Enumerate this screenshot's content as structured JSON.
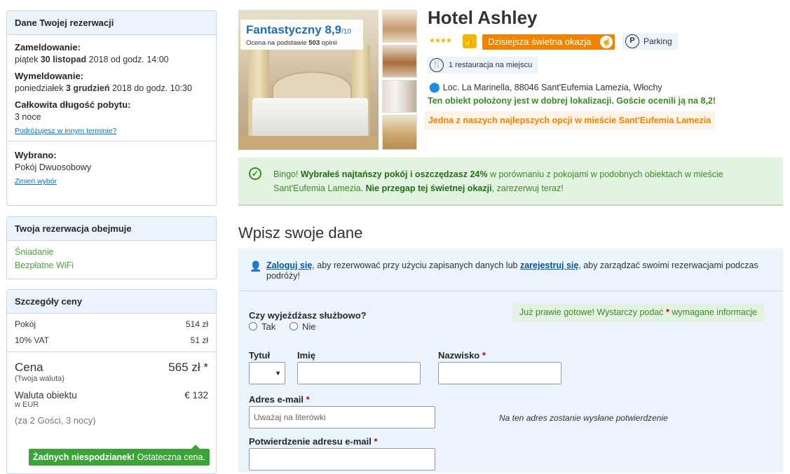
{
  "sidebar": {
    "booking": {
      "title": "Dane Twojej rezerwacji",
      "checkin_label": "Zameldowanie:",
      "checkin_prefix": "piątek",
      "checkin_date": "30 listopad",
      "checkin_suffix": "2018 od godz. 14:00",
      "checkout_label": "Wymeldowanie:",
      "checkout_prefix": "poniedziałek",
      "checkout_date": "3 grudzień",
      "checkout_suffix": "2018 do godz. 10:30",
      "length_label": "Całkowita długość pobytu:",
      "length_value": "3 noce",
      "other_dates_link": "Podróżujesz w innym terminie?",
      "selected_label": "Wybrano:",
      "selected_value": "Pokój Dwuosobowy",
      "change_link": "Zmień wybór"
    },
    "includes": {
      "title": "Twoja rezerwacja obejmuje",
      "items": [
        "Śniadanie",
        "Bezpłatne WiFi"
      ]
    },
    "price": {
      "title": "Szczegóły ceny",
      "rows": [
        {
          "label": "Pokój",
          "value": "514 zł"
        },
        {
          "label": "10% VAT",
          "value": "51 zł"
        }
      ],
      "total_label": "Cena",
      "total_value": "565 zł *",
      "total_note": "(Twoja waluta)",
      "property_currency_label": "Waluta obiektu",
      "property_currency_value": "€ 132",
      "property_currency_note": "w EUR",
      "guests_note": "(za 2 Gości, 3 nocy)",
      "no_surprise_bold": "Żadnych niespodzianek!",
      "no_surprise_rest": " Ostateczna cena."
    }
  },
  "hotel": {
    "rating_word": "Fantastyczny",
    "rating_score": "8,9",
    "rating_scale": "/10",
    "rating_basis_prefix": "Ocena na podstawie ",
    "rating_basis_count": "503",
    "rating_basis_suffix": " opinii",
    "name": "Hotel Ashley",
    "stars": "★★★★",
    "deal_label": "Dzisiejsza świetna okazja",
    "parking_label": "Parking",
    "restaurant_label": "1 restauracja na miejscu",
    "address": "Loc. La Marinella, 88046 Sant'Eufemia Lamezia, Włochy",
    "location_praise": "Ten obiekt położony jest w dobrej lokalizacji. Goście ocenili ją na 8,2!",
    "best_option": "Jedna z naszych najlepszych opcji w mieście Sant'Eufemia Lamezia"
  },
  "bingo": {
    "prefix": "Bingo! ",
    "bold1": "Wybrałeś najtańszy pokój i oszczędzasz 24%",
    "middle": " w porównaniu z pokojami w podobnych obiektach w mieście Sant'Eufemia Lamezia. ",
    "bold2": "Nie przegap tej świetnej okazji",
    "suffix": ", zarezerwuj teraz!"
  },
  "form": {
    "title": "Wpisz swoje dane",
    "login_link": "Zaloguj się",
    "login_mid": ", aby rezerwować przy użyciu zapisanych danych lub ",
    "register_link": "zarejestruj się",
    "login_end": ", aby zarządzać swoimi rezerwacjami podczas podróży!",
    "business_question": "Czy wyjeżdżasz służbowo?",
    "yes": "Tak",
    "no": "Nie",
    "ready_text": "Już prawie gotowe! Wystarczy podać",
    "ready_req": "*",
    "ready_end": "wymagane informacje",
    "title_label": "Tytuł",
    "first_name_label": "Imię",
    "last_name_label": "Nazwisko",
    "email_label": "Adres e-mail",
    "email_placeholder": "Uważaj na literówki",
    "email_note": "Na ten adres zostanie wysłane potwierdzenie",
    "email_confirm_label": "Potwierdzenie adresu e-mail",
    "required_mark": "*"
  }
}
